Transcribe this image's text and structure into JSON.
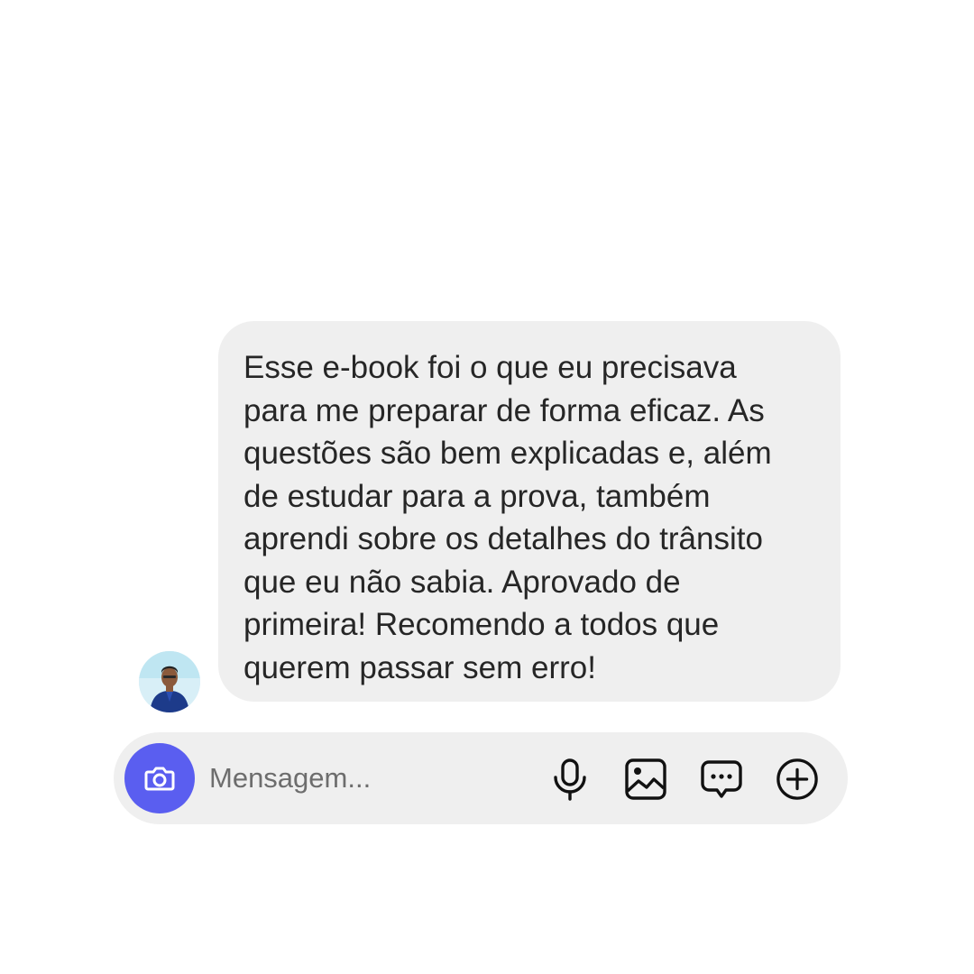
{
  "message": {
    "text": "Esse e-book foi o que eu precisava\npara me preparar de forma eficaz. As\nquestões são bem explicadas e, além\nde estudar para a prova, também\naprendi sobre os detalhes do trânsito\nque eu não sabia. Aprovado de\nprimeira! Recomendo a todos que\nquerem passar sem erro!"
  },
  "composer": {
    "placeholder": "Mensagem...",
    "icons": [
      "camera-icon",
      "microphone-icon",
      "image-icon",
      "chat-icon",
      "plus-circle-icon"
    ]
  },
  "colors": {
    "bubble": "#efefef",
    "text": "#262626",
    "camera_button": "#5a5ef0",
    "placeholder": "#6d6d6d",
    "icon": "#111111"
  }
}
